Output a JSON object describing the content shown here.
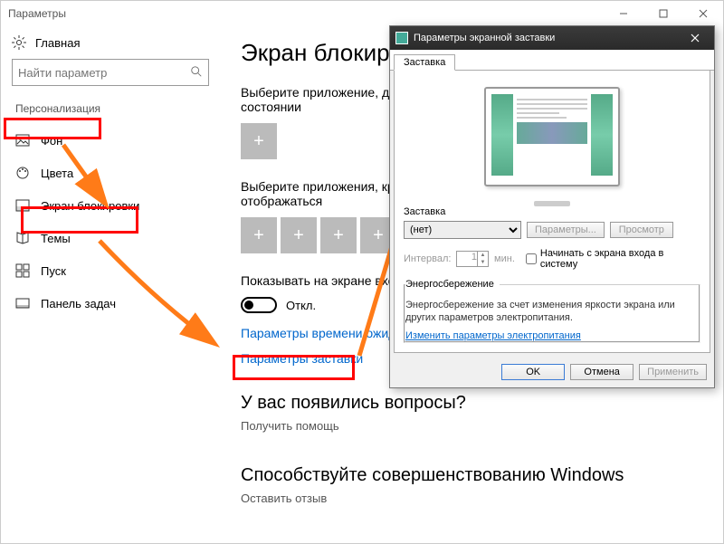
{
  "window": {
    "title": "Параметры"
  },
  "sidebar": {
    "home": "Главная",
    "search_placeholder": "Найти параметр",
    "category": "Персонализация",
    "items": [
      {
        "label": "Фон"
      },
      {
        "label": "Цвета"
      },
      {
        "label": "Экран блокировки"
      },
      {
        "label": "Темы"
      },
      {
        "label": "Пуск"
      },
      {
        "label": "Панель задач"
      }
    ]
  },
  "main": {
    "title": "Экран блокировки",
    "detail_app_label": "Выберите приложение, для которого нужно выводить подробные сведения о состоянии",
    "brief_apps_label": "Выберите приложения, краткие сведения о состоянии которых будут отображаться",
    "show_on_login_label": "Показывать на экране входа фоновый рисунок экрана блокировки",
    "toggle_state": "Откл.",
    "timeout_link": "Параметры времени ожидания экрана",
    "screensaver_link": "Параметры заставки",
    "questions_heading": "У вас появились вопросы?",
    "get_help": "Получить помощь",
    "improve_heading": "Способствуйте совершенствованию Windows",
    "feedback": "Оставить отзыв"
  },
  "dialog": {
    "title": "Параметры экранной заставки",
    "tab": "Заставка",
    "section_label": "Заставка",
    "screensaver_value": "(нет)",
    "params_btn": "Параметры...",
    "preview_btn": "Просмотр",
    "interval_label": "Интервал:",
    "interval_value": "1",
    "interval_unit": "мин.",
    "resume_checkbox": "Начинать с экрана входа в систему",
    "energy_legend": "Энергосбережение",
    "energy_text": "Энергосбережение за счет изменения яркости экрана или других параметров электропитания.",
    "energy_link": "Изменить параметры электропитания",
    "ok": "OK",
    "cancel": "Отмена",
    "apply": "Применить"
  }
}
